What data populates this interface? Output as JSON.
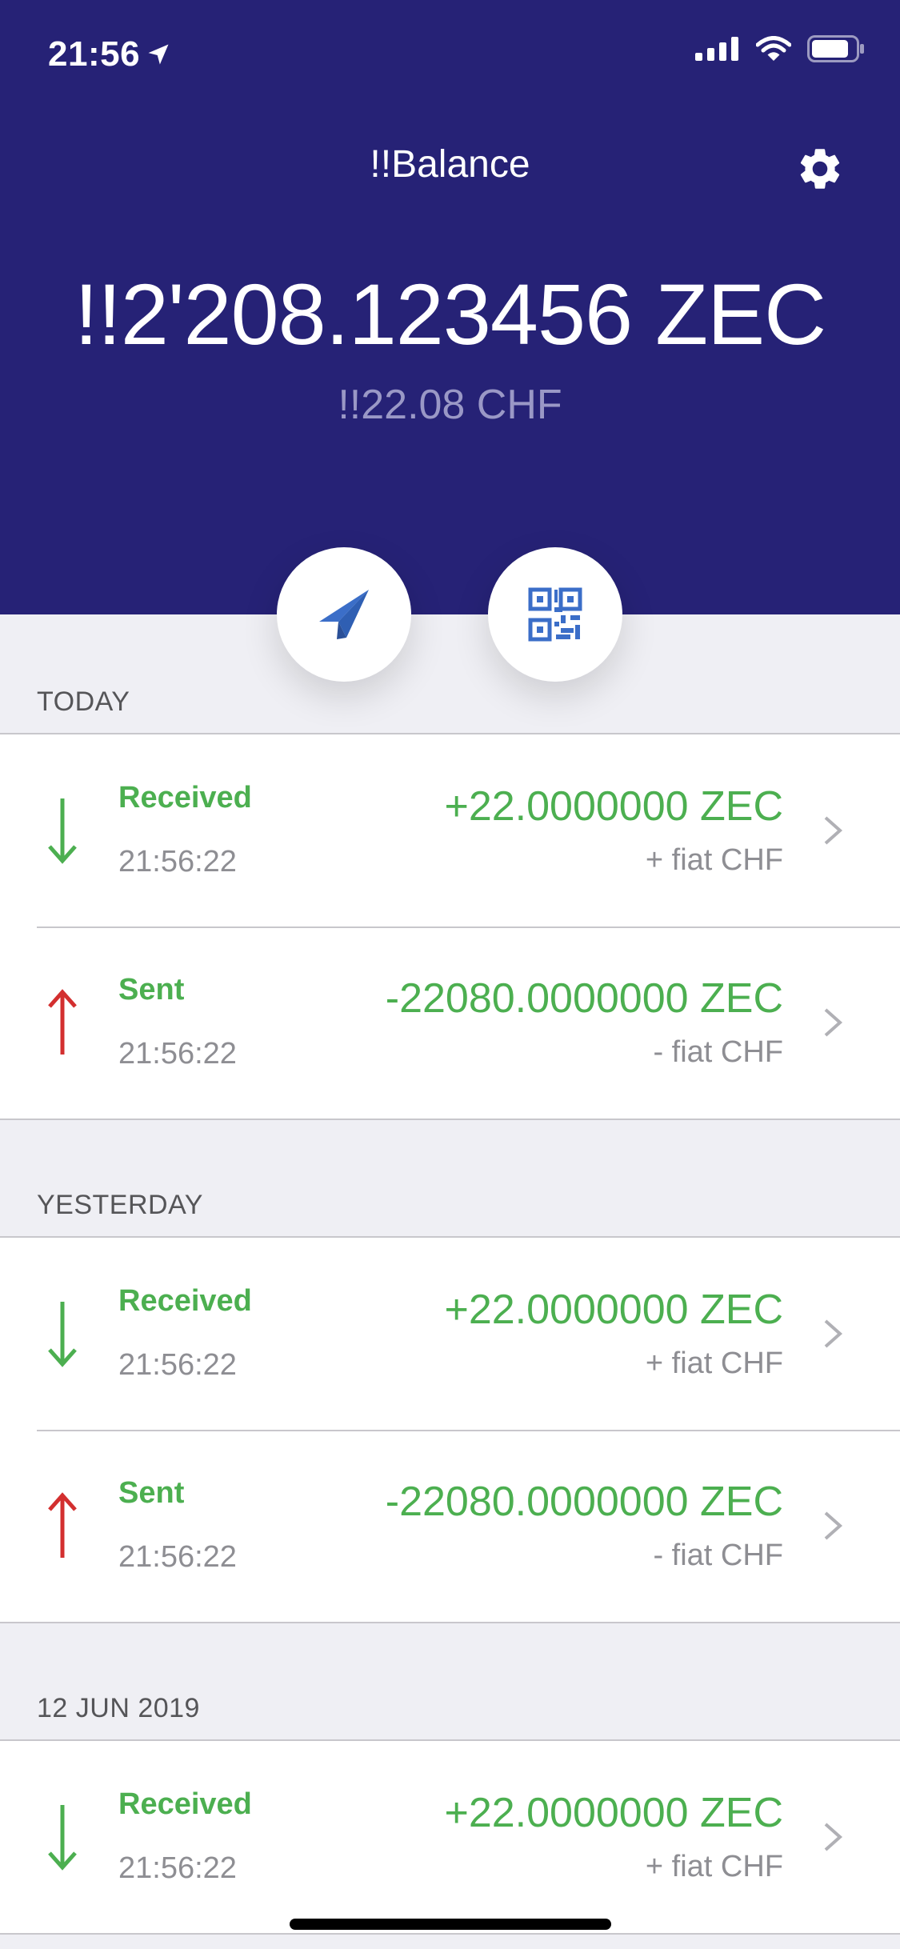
{
  "status_bar": {
    "time": "21:56",
    "icons": [
      "location-arrow-icon",
      "signal-bars-icon",
      "wifi-icon",
      "battery-icon"
    ]
  },
  "header": {
    "title": "!!Balance",
    "balance": "!!2'208.123456 ZEC",
    "fiat_balance": "!!22.08 CHF",
    "settings_icon": "gear-icon"
  },
  "actions": {
    "send_icon": "paper-plane-icon",
    "receive_icon": "qr-code-icon"
  },
  "colors": {
    "header_background": "#262276",
    "positive_green": "#4caf50",
    "sent_red": "#d32f2f",
    "icon_blue": "#3b6ec8",
    "secondary_gray": "#8e8e93"
  },
  "sections": [
    {
      "label": "TODAY",
      "transactions": [
        {
          "direction": "received",
          "type": "Received",
          "time": "21:56:22",
          "amount": "+22.0000000 ZEC",
          "fiat": "+ fiat CHF"
        },
        {
          "direction": "sent",
          "type": "Sent",
          "time": "21:56:22",
          "amount": "-22080.0000000 ZEC",
          "fiat": "- fiat CHF"
        }
      ]
    },
    {
      "label": "YESTERDAY",
      "transactions": [
        {
          "direction": "received",
          "type": "Received",
          "time": "21:56:22",
          "amount": "+22.0000000 ZEC",
          "fiat": "+ fiat CHF"
        },
        {
          "direction": "sent",
          "type": "Sent",
          "time": "21:56:22",
          "amount": "-22080.0000000 ZEC",
          "fiat": "- fiat CHF"
        }
      ]
    },
    {
      "label": "12 JUN 2019",
      "transactions": [
        {
          "direction": "received",
          "type": "Received",
          "time": "21:56:22",
          "amount": "+22.0000000 ZEC",
          "fiat": "+ fiat CHF"
        }
      ]
    }
  ]
}
